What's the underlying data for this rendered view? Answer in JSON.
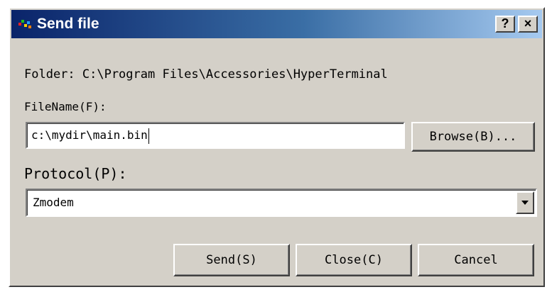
{
  "window": {
    "title": "Send file",
    "help_label": "?",
    "close_label": "×"
  },
  "folder": {
    "text": "Folder: C:\\Program Files\\Accessories\\HyperTerminal"
  },
  "filename": {
    "label": "FileName(F):",
    "value": "c:\\mydir\\main.bin",
    "browse_label": "Browse(B)..."
  },
  "protocol": {
    "label": "Protocol(P):",
    "selected": "Zmodem"
  },
  "buttons": {
    "send": "Send(S)",
    "close": "Close(C)",
    "cancel": "Cancel"
  },
  "colors": {
    "titlebar_start": "#0a246a",
    "titlebar_end": "#a6caf0",
    "dialog_face": "#d4d0c8"
  },
  "icons": {
    "app": "hyperterminal-icon",
    "dropdown": "chevron-down-icon"
  }
}
